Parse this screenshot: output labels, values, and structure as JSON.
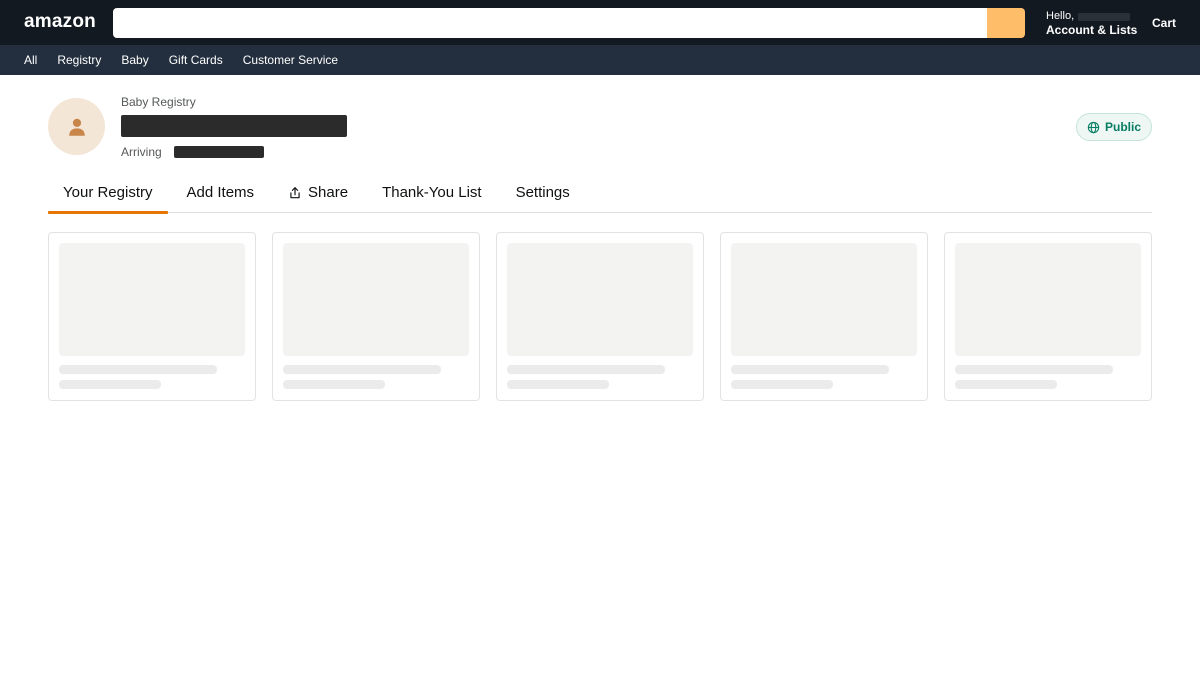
{
  "header": {
    "logo": "amazon",
    "search": {
      "value": "",
      "placeholder": ""
    },
    "account": {
      "greeting": "Hello,",
      "lists_label": "Account & Lists"
    },
    "cart_label": "Cart"
  },
  "subnav": {
    "items": [
      {
        "label": "All"
      },
      {
        "label": "Registry"
      },
      {
        "label": "Baby"
      },
      {
        "label": "Gift Cards"
      },
      {
        "label": "Customer Service"
      }
    ]
  },
  "registry": {
    "type_label": "Baby Registry",
    "arriving_label": "Arriving",
    "visibility": "Public"
  },
  "tabs": [
    {
      "label": "Your Registry",
      "active": true
    },
    {
      "label": "Add Items"
    },
    {
      "label": "Share",
      "icon": "share-icon"
    },
    {
      "label": "Thank-You List"
    },
    {
      "label": "Settings"
    }
  ],
  "colors": {
    "topbar": "#131921",
    "subnav": "#232f3e",
    "search_button": "#febd69",
    "tab_active_underline": "#e77600",
    "public_badge_text": "#067d62",
    "avatar_bg": "#f4e6d6",
    "avatar_icon": "#c8864a"
  },
  "skeleton_cards": 5
}
